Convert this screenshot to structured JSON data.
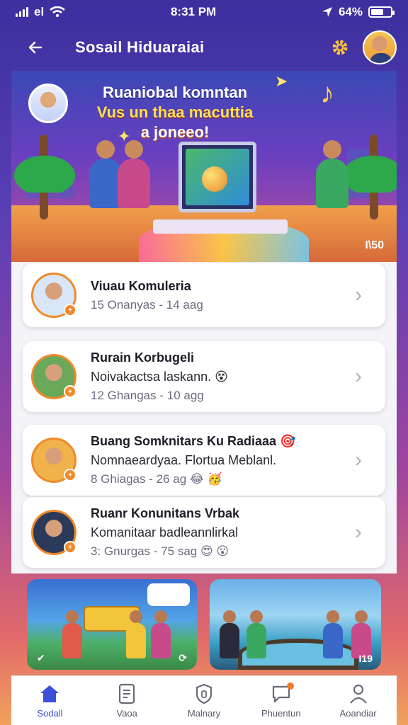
{
  "status_bar": {
    "carrier": "el",
    "time": "8:31 PM",
    "battery": "64%",
    "battery_level": 0.64
  },
  "header": {
    "title": "Sosail Hiduaraiai",
    "icons": [
      "back-arrow-icon",
      "gear-icon",
      "avatar"
    ]
  },
  "hero": {
    "line1": "Ruaniobal komntan",
    "line2": "Vus un thaa macuttia",
    "line3": "a joneeo!",
    "badge": "I\\50"
  },
  "communities": [
    {
      "title": "Viuau Komuleria",
      "desc": "",
      "meta": "15 Onanyas - 14 aag",
      "avatar_bg": "#d8e6f7",
      "emoji": ""
    },
    {
      "title": "Rurain Korbugeli",
      "desc": "Noivakactsa laskann. 😵",
      "meta": "12 Ghangas - 10 agg",
      "avatar_bg": "#6aa85a",
      "emoji": ""
    },
    {
      "title": "Buang Somknitars Ku Radiaaa 🎯",
      "desc": "Nomnaeardyaa. Flortua Meblanl.",
      "meta": "8 Ghiagas - 26 ag 😂 🥳",
      "avatar_bg": "#f0b24a",
      "emoji": ""
    },
    {
      "title": "Ruanr Konunitans Vrbak",
      "desc": "Komanitaar badleannlirkal",
      "meta": "3: Gnurgas - 75 sag 😍 😮",
      "avatar_bg": "#2c3a5a",
      "emoji": ""
    }
  ],
  "thumbnails": [
    {
      "corner_label": "✔",
      "corner_right": "⟳"
    },
    {
      "corner_label": "",
      "corner_right": "I19"
    }
  ],
  "tabs": [
    {
      "label": "Sodall",
      "icon": "home-icon",
      "active": true
    },
    {
      "label": "Vaoa",
      "icon": "document-icon",
      "active": false
    },
    {
      "label": "Malnary",
      "icon": "shield-icon",
      "active": false
    },
    {
      "label": "Phuentun",
      "icon": "chat-icon",
      "active": false
    },
    {
      "label": "Aoandiar",
      "icon": "profile-icon",
      "active": false
    }
  ]
}
